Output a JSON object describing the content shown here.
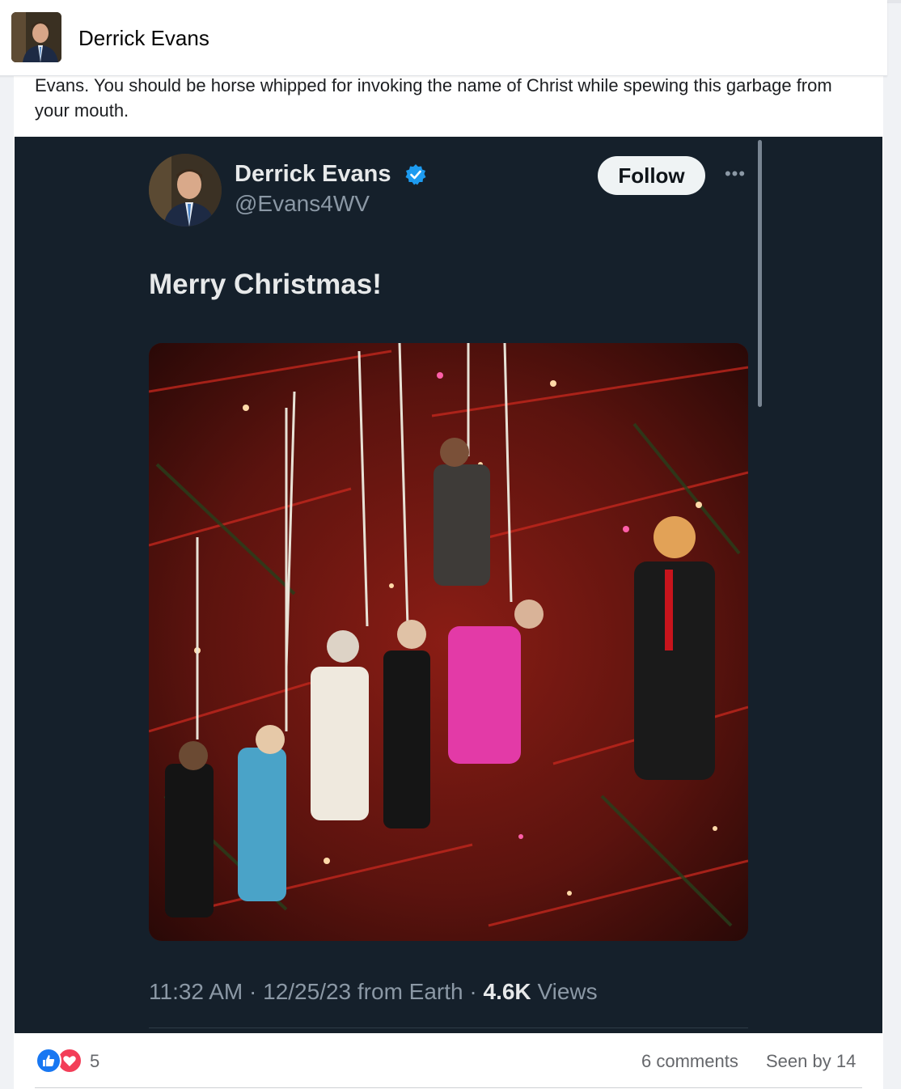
{
  "post": {
    "author_name": "Derrick Evans",
    "text": "Evans. You should be horse whipped for invoking the name of Christ while spewing this garbage from your mouth."
  },
  "embedded_tweet": {
    "display_name": "Derrick Evans",
    "handle": "@Evans4WV",
    "follow_label": "Follow",
    "more_label": "•••",
    "text": "Merry Christmas!",
    "time": "11:32 AM",
    "date": "12/25/23",
    "source": "from Earth",
    "views_count": "4.6K",
    "views_label": "Views",
    "meta_separator": "·"
  },
  "footer": {
    "reaction_count": "5",
    "comments": "6 comments",
    "seen": "Seen by 14"
  },
  "icons": {
    "like": "like-icon",
    "love": "love-icon",
    "verified": "verified-badge-icon"
  },
  "colors": {
    "tweet_background": "#15202b",
    "verified_blue": "#1d9bf0",
    "like_blue": "#1877f2",
    "love_red": "#f33e58"
  }
}
